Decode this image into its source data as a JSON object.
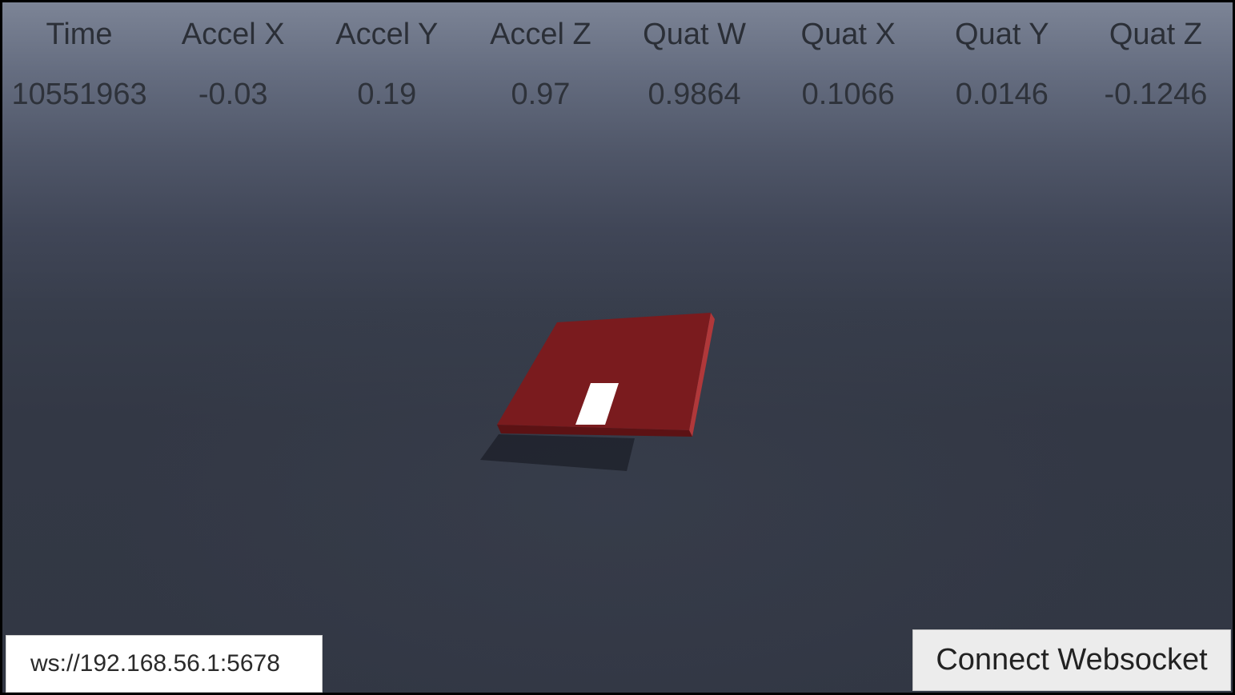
{
  "telemetry": {
    "columns": [
      "Time",
      "Accel X",
      "Accel Y",
      "Accel Z",
      "Quat W",
      "Quat X",
      "Quat Y",
      "Quat Z"
    ],
    "values": [
      "10551963",
      "-0.03",
      "0.19",
      "0.97",
      "0.9864",
      "0.1066",
      "0.0146",
      "-0.1246"
    ]
  },
  "scene": {
    "board_color": "#7a1b1e",
    "board_edge_color": "#5c1214",
    "board_side_color": "#b0383a",
    "marker_color": "#ffffff",
    "shadow_color": "#1e222c"
  },
  "connection": {
    "url_value": "ws://192.168.56.1:5678",
    "connect_label": "Connect Websocket"
  }
}
